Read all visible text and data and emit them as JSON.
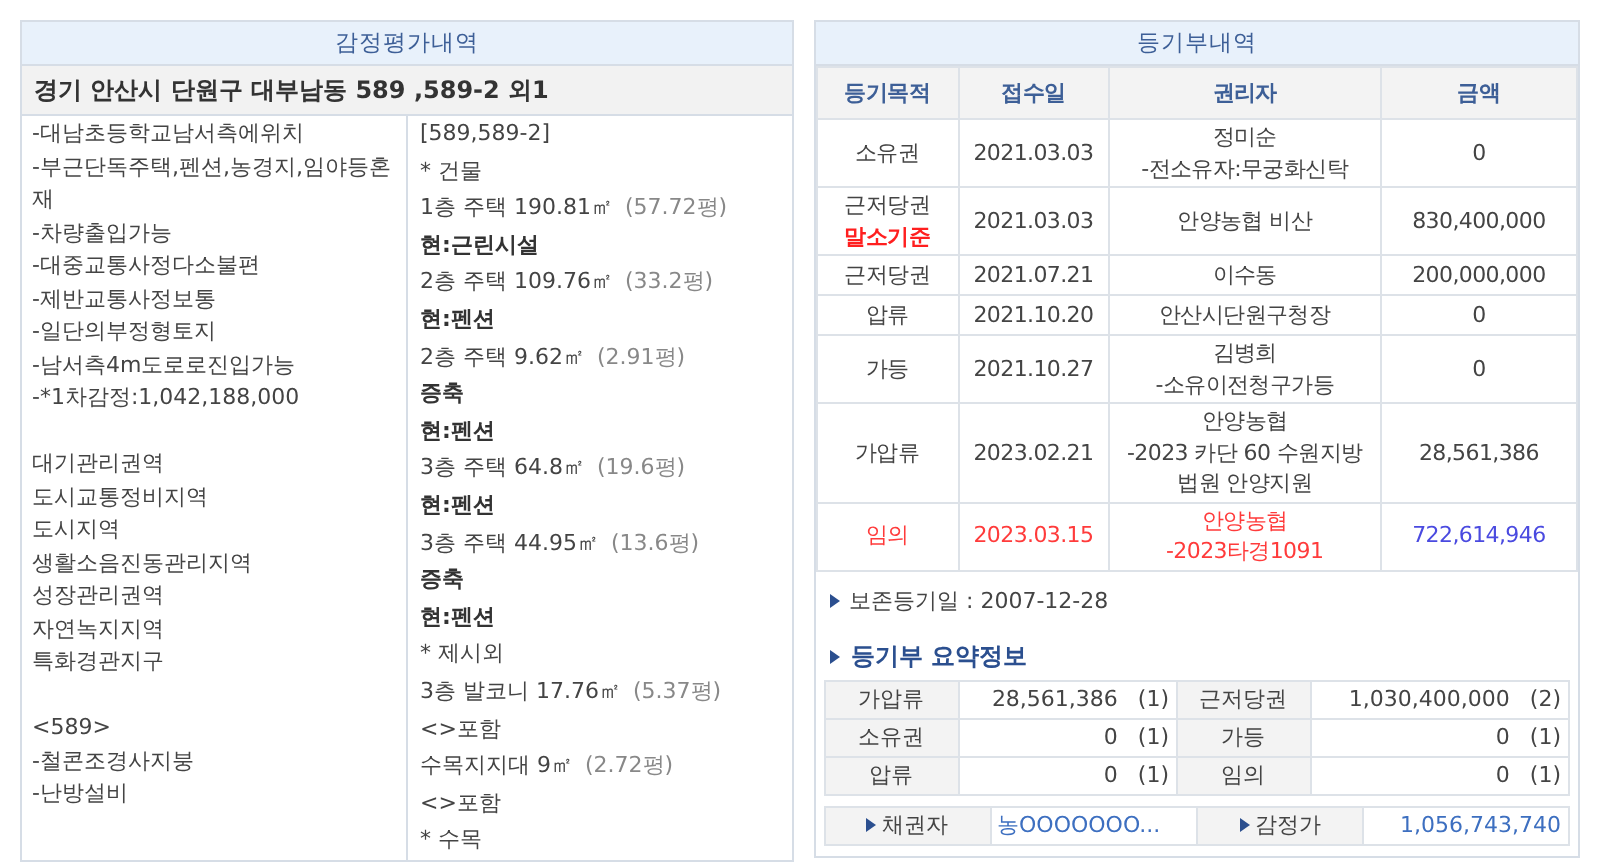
{
  "appraisal": {
    "title": "감정평가내역",
    "address": "경기 안산시 단원구 대부남동 589 ,589-2 외1",
    "note_groups": [
      [
        "-대남초등학교남서측에위치",
        "-부근단독주택,펜션,농경지,임야등혼재",
        "-차량출입가능",
        "-대중교통사정다소불편",
        "-제반교통사정보통",
        "-일단의부정형토지",
        "-남서측4m도로로진입가능",
        "-*1차감정:1,042,188,000"
      ],
      [
        "대기관리권역",
        "도시교통정비지역",
        "도시지역",
        "생활소음진동관리지역",
        "성장관리권역",
        "자연녹지지역",
        "특화경관지구"
      ],
      [
        "<589>",
        "-철콘조경사지붕",
        "-난방설비"
      ]
    ],
    "details": [
      {
        "kind": "plain",
        "text": "[589,589-2]"
      },
      {
        "kind": "plain",
        "text": "* 건물"
      },
      {
        "kind": "area",
        "text": "1층 주택 190.81㎡",
        "sub": "(57.72평)"
      },
      {
        "kind": "bold",
        "text": "현:근린시설"
      },
      {
        "kind": "area",
        "text": "2층 주택 109.76㎡",
        "sub": "(33.2평)"
      },
      {
        "kind": "bold",
        "text": "현:펜션"
      },
      {
        "kind": "area",
        "text": "2층 주택 9.62㎡",
        "sub": "(2.91평)"
      },
      {
        "kind": "bold",
        "text": "증축"
      },
      {
        "kind": "bold",
        "text": "현:펜션"
      },
      {
        "kind": "area",
        "text": "3층 주택 64.8㎡",
        "sub": "(19.6평)"
      },
      {
        "kind": "bold",
        "text": "현:펜션"
      },
      {
        "kind": "area",
        "text": "3층 주택 44.95㎡",
        "sub": "(13.6평)"
      },
      {
        "kind": "bold",
        "text": "증축"
      },
      {
        "kind": "bold",
        "text": "현:펜션"
      },
      {
        "kind": "plain",
        "text": "* 제시외"
      },
      {
        "kind": "area",
        "text": "3층 발코니 17.76㎡",
        "sub": "(5.37평)"
      },
      {
        "kind": "plain",
        "text": "<>포함"
      },
      {
        "kind": "area",
        "text": "수목지지대 9㎡",
        "sub": "(2.72평)"
      },
      {
        "kind": "plain",
        "text": "<>포함"
      },
      {
        "kind": "plain",
        "text": "* 수목"
      }
    ]
  },
  "registry": {
    "title": "등기부내역",
    "columns": [
      "등기목적",
      "접수일",
      "권리자",
      "금액"
    ],
    "rows": [
      {
        "purpose": "소유권",
        "date": "2021.03.03",
        "holder": [
          "정미순",
          "-전소유자:무궁화신탁"
        ],
        "amount": "0",
        "highlighted": false
      },
      {
        "purpose": "근저당권",
        "purpose_note": "말소기준",
        "date": "2021.03.03",
        "holder": [
          "안양농협 비산"
        ],
        "amount": "830,400,000",
        "highlighted": false
      },
      {
        "purpose": "근저당권",
        "date": "2021.07.21",
        "holder": [
          "이수동"
        ],
        "amount": "200,000,000",
        "highlighted": false
      },
      {
        "purpose": "압류",
        "date": "2021.10.20",
        "holder": [
          "안산시단원구청장"
        ],
        "amount": "0",
        "highlighted": false
      },
      {
        "purpose": "가등",
        "date": "2021.10.27",
        "holder": [
          "김병희",
          "-소유이전청구가등"
        ],
        "amount": "0",
        "highlighted": false
      },
      {
        "purpose": "가압류",
        "date": "2023.02.21",
        "holder": [
          "안양농협",
          "-2023 카단 60 수원지방",
          "법원 안양지원"
        ],
        "amount": "28,561,386",
        "highlighted": false
      },
      {
        "purpose": "임의",
        "date": "2023.03.15",
        "holder": [
          "안양농협",
          "-2023타경1091"
        ],
        "amount": "722,614,946",
        "highlighted": true
      }
    ],
    "preservation": "보존등기일 : 2007-12-28",
    "summary_title": "등기부 요약정보",
    "summary": [
      [
        {
          "label": "가압류",
          "amount": "28,561,386",
          "count": "(1)"
        },
        {
          "label": "근저당권",
          "amount": "1,030,400,000",
          "count": "(2)"
        }
      ],
      [
        {
          "label": "소유권",
          "amount": "0",
          "count": "(1)"
        },
        {
          "label": "가등",
          "amount": "0",
          "count": "(1)"
        }
      ],
      [
        {
          "label": "압류",
          "amount": "0",
          "count": "(1)"
        },
        {
          "label": "임의",
          "amount": "0",
          "count": "(1)"
        }
      ]
    ],
    "info": [
      {
        "label": "채권자",
        "value": "농OOOOOOO...",
        "kind": "link"
      },
      {
        "label": "감정가",
        "value": "1,056,743,740",
        "kind": "number"
      }
    ]
  }
}
